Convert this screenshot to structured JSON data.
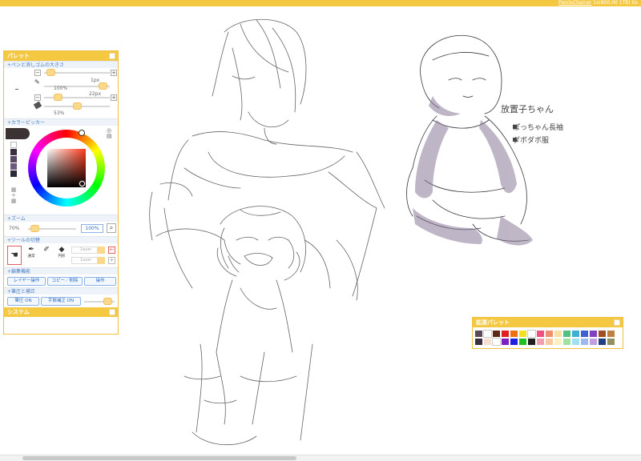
{
  "topbar": {
    "app": "PaintsChainer",
    "info": "1x(800,00 1TB) 0x"
  },
  "palette": {
    "title": "パレット",
    "pen_section": "+ペンと消しゴムの大きさ",
    "pen_size": "1px",
    "pen_opacity": "100%",
    "eraser_size": "22px",
    "eraser_opacity": "53%",
    "color_section": "+カラーピッカー",
    "zoom_section": "+ズーム",
    "zoom_value": "70%",
    "zoom_input": "100%",
    "tool_section": "+ツールの切替",
    "tool_normal": "通常",
    "tool_circle": "円形",
    "layer_placeholder": "1ayer",
    "edit_section": "+編集機能",
    "btn_layer": "レイヤー操作",
    "btn_copy": "コピー／削除",
    "btn_op": "操作",
    "correct_section": "+筆圧と補正",
    "btn_pressure": "筆圧 ON",
    "btn_stabilizer": "手振補正 ON",
    "system": "システム"
  },
  "extended_palette": {
    "title": "拡張パレット",
    "colors": [
      "#5a4a58",
      "#ffffff",
      "#5c2a16",
      "#e02020",
      "#f07010",
      "#f5e020",
      "#ffffff",
      "#f05080",
      "#f09070",
      "#f8e0a0",
      "#50c080",
      "#40b0d0",
      "#4060d0",
      "#8040c0",
      "#a05020",
      "#c08040",
      "#3a3040",
      "#f7e0d0",
      "#ffffff",
      "#8020c0",
      "#2020e0",
      "#20c020",
      "#202020",
      "#f0a0b0",
      "#f8c8a0",
      "#fff0c0",
      "#a0e0a0",
      "#a0e0f0",
      "#a0b8f0",
      "#c0a0e0",
      "#204080",
      "#909060"
    ]
  },
  "sketch": {
    "note_title": "放置子ちゃん",
    "note_line1": "ぽっちゃん長袖",
    "note_line2": "ダボダボ服"
  }
}
